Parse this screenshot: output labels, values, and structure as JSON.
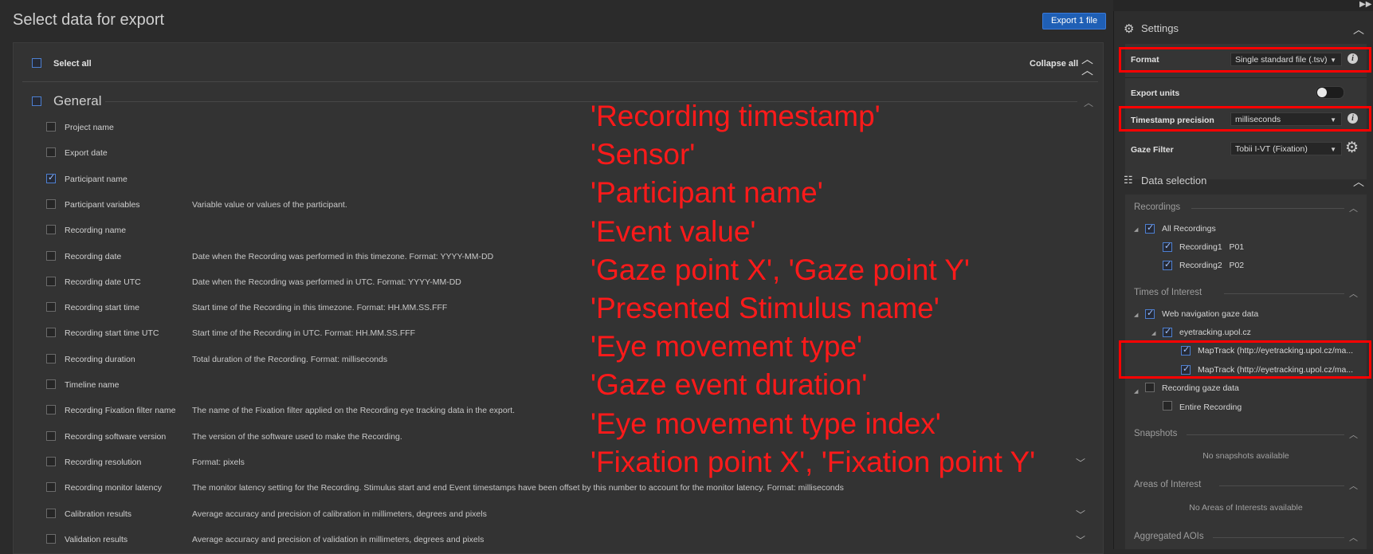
{
  "header": {
    "title": "Select data for export",
    "export_button": "Export 1 file"
  },
  "panel": {
    "select_all": "Select all",
    "collapse_all": "Collapse all",
    "section_title": "General",
    "rows": [
      {
        "label": "Project name",
        "desc": "",
        "checked": false
      },
      {
        "label": "Export date",
        "desc": "",
        "checked": false
      },
      {
        "label": "Participant name",
        "desc": "",
        "checked": true
      },
      {
        "label": "Participant variables",
        "desc": "Variable value or values of the participant.",
        "checked": false
      },
      {
        "label": "Recording name",
        "desc": "",
        "checked": false
      },
      {
        "label": "Recording date",
        "desc": "Date when the Recording was performed in this timezone. Format: YYYY-MM-DD",
        "checked": false
      },
      {
        "label": "Recording date UTC",
        "desc": "Date when the Recording was performed in UTC. Format: YYYY-MM-DD",
        "checked": false
      },
      {
        "label": "Recording start time",
        "desc": "Start time of the Recording in this timezone. Format: HH.MM.SS.FFF",
        "checked": false
      },
      {
        "label": "Recording start time UTC",
        "desc": "Start time of the Recording in UTC. Format: HH.MM.SS.FFF",
        "checked": false
      },
      {
        "label": "Recording duration",
        "desc": "Total duration of the Recording. Format: milliseconds",
        "checked": false
      },
      {
        "label": "Timeline name",
        "desc": "",
        "checked": false
      },
      {
        "label": "Recording Fixation filter name",
        "desc": "The name of the Fixation filter applied on the Recording eye tracking data in the export.",
        "checked": false
      },
      {
        "label": "Recording software version",
        "desc": "The version of the software used to make the Recording.",
        "checked": false
      },
      {
        "label": "Recording resolution",
        "desc": "Format: pixels",
        "checked": false
      },
      {
        "label": "Recording monitor latency",
        "desc": "The monitor latency setting for the Recording. Stimulus start and end Event timestamps have been offset by this number to account for the monitor latency. Format: milliseconds",
        "checked": false
      },
      {
        "label": "Calibration results",
        "desc": "Average accuracy and precision of calibration in millimeters, degrees and pixels",
        "checked": false
      },
      {
        "label": "Validation results",
        "desc": "Average accuracy and precision of validation in millimeters, degrees and pixels",
        "checked": false
      }
    ]
  },
  "annotations": [
    "'Recording timestamp'",
    "'Sensor'",
    "'Participant name'",
    "'Event value'",
    "'Gaze point X', 'Gaze point Y'",
    "'Presented Stimulus name'",
    "'Eye movement type'",
    "'Gaze event duration'",
    "'Eye movement type index'",
    "'Fixation point X', 'Fixation point Y'"
  ],
  "settings": {
    "title": "Settings",
    "format_label": "Format",
    "format_value": "Single standard file (.tsv)",
    "export_units_label": "Export units",
    "export_units_on": false,
    "timestamp_label": "Timestamp precision",
    "timestamp_value": "milliseconds",
    "gaze_filter_label": "Gaze Filter",
    "gaze_filter_value": "Tobii I-VT (Fixation)"
  },
  "data_selection": {
    "title": "Data selection",
    "recordings_head": "Recordings",
    "all_recordings": "All Recordings",
    "recording1": "Recording1   P01",
    "recording2": "Recording2   P02",
    "toi_head": "Times of Interest",
    "web_nav": "Web navigation gaze data",
    "domain": "eyetracking.upol.cz",
    "maptrack1": "MapTrack (http://eyetracking.upol.cz/ma...",
    "maptrack2": "MapTrack (http://eyetracking.upol.cz/ma...",
    "rec_gaze": "Recording gaze data",
    "entire_rec": "Entire Recording",
    "snapshots_head": "Snapshots",
    "no_snapshots": "No snapshots available",
    "aoi_head": "Areas of Interest",
    "no_aoi": "No Areas of Interests available",
    "agg_head": "Aggregated AOIs"
  },
  "colors": {
    "accent": "#1f5fb5",
    "highlight": "#ff0000",
    "annotation_text": "#ff1a1a"
  }
}
